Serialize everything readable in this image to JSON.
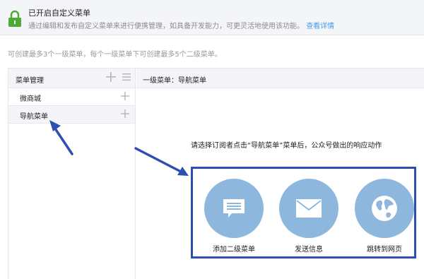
{
  "notice": {
    "title": "已开启自定义菜单",
    "description": "通过编辑和发布自定义菜单来进行便携管理，如具备开发能力，可更灵活地使用该功能。",
    "link": "查看详情"
  },
  "limit_tip": "可创建最多3个一级菜单，每个一级菜单下可创建最多5个二级菜单。",
  "sidebar": {
    "title": "菜单管理",
    "items": [
      {
        "label": "微商城"
      },
      {
        "label": "导航菜单"
      }
    ]
  },
  "main": {
    "header": "一级菜单：导航菜单",
    "prompt": "请选择订阅者点击“导航菜单”菜单后，公众号做出的响应动作",
    "actions": [
      {
        "label": "添加二级菜单",
        "icon": "submenu-icon"
      },
      {
        "label": "发送信息",
        "icon": "envelope-icon"
      },
      {
        "label": "跳转到网页",
        "icon": "globe-icon"
      }
    ]
  },
  "colors": {
    "accent": "#2d4fb0",
    "circle": "#8eb7dd",
    "link": "#459ae9",
    "lock": "#4fa937"
  }
}
